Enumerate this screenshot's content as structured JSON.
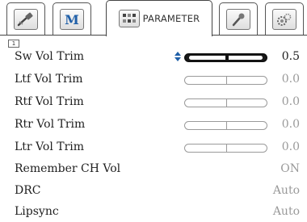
{
  "tabs": [
    {
      "name": "tab-audio-input",
      "icon": "cable-plug-icon",
      "label": ""
    },
    {
      "name": "tab-mode",
      "icon": "m-logo-icon",
      "label": ""
    },
    {
      "name": "tab-parameter",
      "icon": "speaker-grid-icon",
      "label": "PARAMETER",
      "active": true
    },
    {
      "name": "tab-microphone",
      "icon": "microphone-icon",
      "label": ""
    },
    {
      "name": "tab-settings",
      "icon": "gears-icon",
      "label": ""
    }
  ],
  "page_number": "1",
  "rows": [
    {
      "label": "Sw Vol Trim",
      "value": "0.5",
      "type": "slider",
      "level": 0.52,
      "selected": true
    },
    {
      "label": "Ltf Vol Trim",
      "value": "0.0",
      "type": "slider",
      "level": 0.5
    },
    {
      "label": "Rtf Vol Trim",
      "value": "0.0",
      "type": "slider",
      "level": 0.5
    },
    {
      "label": "Rtr Vol Trim",
      "value": "0.0",
      "type": "slider",
      "level": 0.5
    },
    {
      "label": "Ltr Vol Trim",
      "value": "0.0",
      "type": "slider",
      "level": 0.5
    },
    {
      "label": "Remember CH Vol",
      "value": "ON",
      "type": "text"
    },
    {
      "label": "DRC",
      "value": "Auto",
      "type": "text"
    },
    {
      "label": "Lipsync",
      "value": "Auto",
      "type": "text"
    }
  ],
  "colors": {
    "selected_value": "#1e1e1e",
    "inactive_value": "#9a9a9a",
    "slider_fill": "#1a1a1a"
  }
}
